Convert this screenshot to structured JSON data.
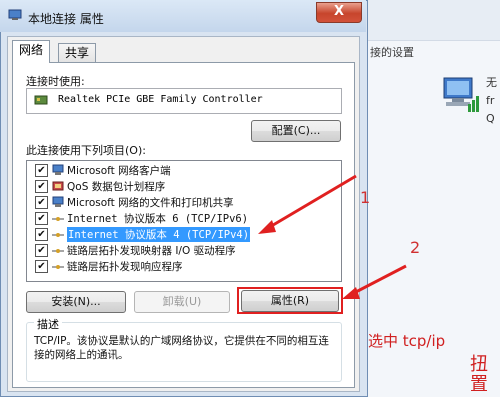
{
  "dialog": {
    "title": "本地连接 属性",
    "close_label": "X",
    "tabs": [
      {
        "label": "网络"
      },
      {
        "label": "共享"
      }
    ],
    "connect_using_label": "连接时使用:",
    "adapter_name": "Realtek PCIe GBE Family Controller",
    "configure_button": "配置(C)...",
    "items_label": "此连接使用下列项目(O):",
    "items": [
      {
        "label": "Microsoft 网络客户端",
        "checked": true,
        "icon": "network-client-icon"
      },
      {
        "label": "QoS 数据包计划程序",
        "checked": true,
        "icon": "qos-icon"
      },
      {
        "label": "Microsoft 网络的文件和打印机共享",
        "checked": true,
        "icon": "share-icon"
      },
      {
        "label": "Internet 协议版本 6 (TCP/IPv6)",
        "checked": true,
        "icon": "protocol-icon"
      },
      {
        "label": "Internet 协议版本 4 (TCP/IPv4)",
        "checked": true,
        "icon": "protocol-icon",
        "selected": true
      },
      {
        "label": "链路层拓扑发现映射器 I/O 驱动程序",
        "checked": true,
        "icon": "protocol-icon"
      },
      {
        "label": "链路层拓扑发现响应程序",
        "checked": true,
        "icon": "protocol-icon"
      }
    ],
    "install_button": "安装(N)...",
    "uninstall_button": "卸载(U)",
    "properties_button": "属性(R)",
    "description_title": "描述",
    "description_text": "TCP/IP。该协议是默认的广域网络协议，它提供在不同的相互连接的网络上的通讯。"
  },
  "background": {
    "link_text": "接的设置",
    "network_labels": [
      "无",
      "fr",
      "Q"
    ]
  },
  "annotations": {
    "num1": "1",
    "num2": "2",
    "instruction_line1": "选中 tcp/ip",
    "instruction_line2_chars": [
      "扭",
      "置"
    ],
    "color": "#e02020"
  }
}
